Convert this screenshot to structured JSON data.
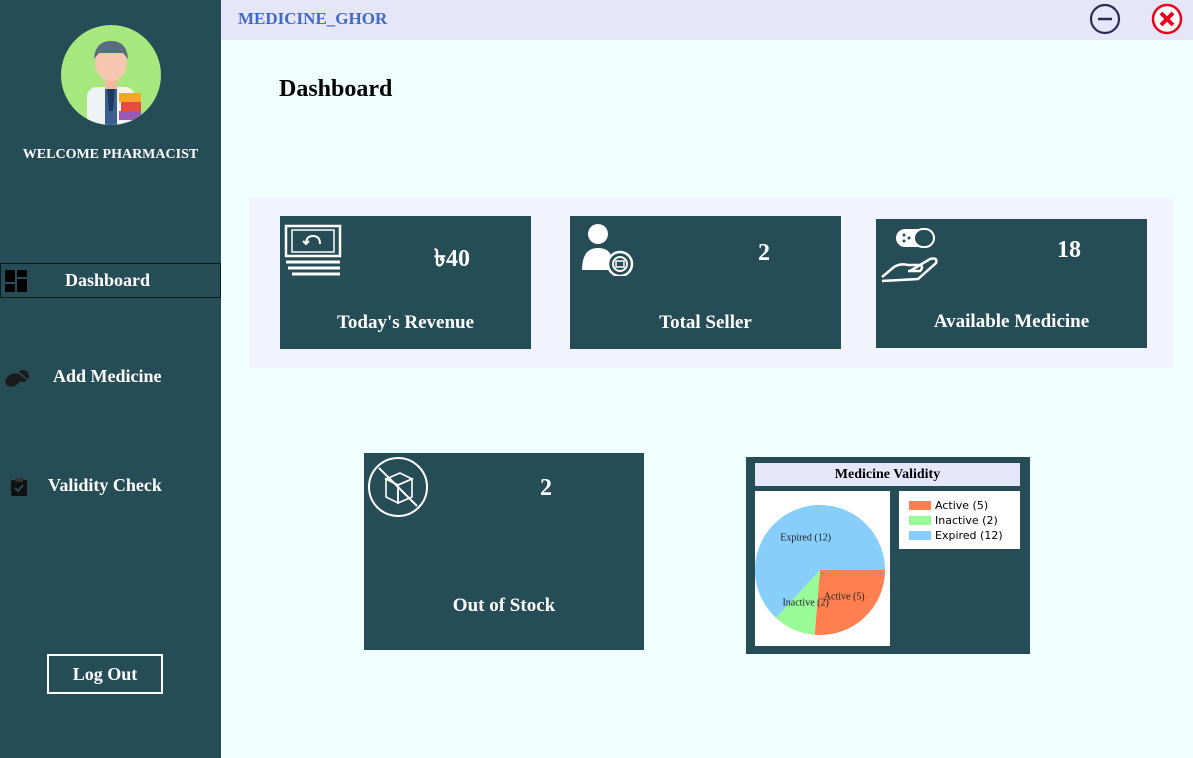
{
  "titlebar": {
    "app_title": "MEDICINE_GHOR",
    "minimize_icon": "minimize-circle-icon",
    "close_icon": "close-circle-icon"
  },
  "sidebar": {
    "welcome": "WELCOME PHARMACIST",
    "items": [
      {
        "label": "Dashboard",
        "icon": "dashboard-icon",
        "active": true
      },
      {
        "label": "Add Medicine",
        "icon": "pills-icon",
        "active": false
      },
      {
        "label": "Validity Check",
        "icon": "clipboard-check-icon",
        "active": false
      }
    ],
    "logout_label": "Log Out"
  },
  "main": {
    "title": "Dashboard",
    "cards": [
      {
        "label": "Today's Revenue",
        "value": "৳40",
        "icon": "money-stack-icon"
      },
      {
        "label": "Total Seller",
        "value": "2",
        "icon": "seller-icon"
      },
      {
        "label": "Available Medicine",
        "value": "18",
        "icon": "medicine-hand-icon"
      },
      {
        "label": "Out of Stock",
        "value": "2",
        "icon": "no-box-icon"
      }
    ]
  },
  "colors": {
    "sidebar_bg": "#264c56",
    "page_bg": "#f0ffff",
    "titlebar_bg": "#e6e6fa",
    "title_text": "#4169c8",
    "close_red": "#e8001c"
  },
  "chart_data": {
    "type": "pie",
    "title": "Medicine Validity",
    "categories": [
      "Active",
      "Inactive",
      "Expired"
    ],
    "values": [
      5,
      2,
      12
    ],
    "slice_labels": [
      "Active (5)",
      "Inactive (2)",
      "Expired (12)"
    ],
    "colors": [
      "#ff7f50",
      "#98fb98",
      "#87cefa"
    ],
    "legend": {
      "position": "right",
      "entries": [
        "Active (5)",
        "Inactive (2)",
        "Expired (12)"
      ]
    }
  }
}
